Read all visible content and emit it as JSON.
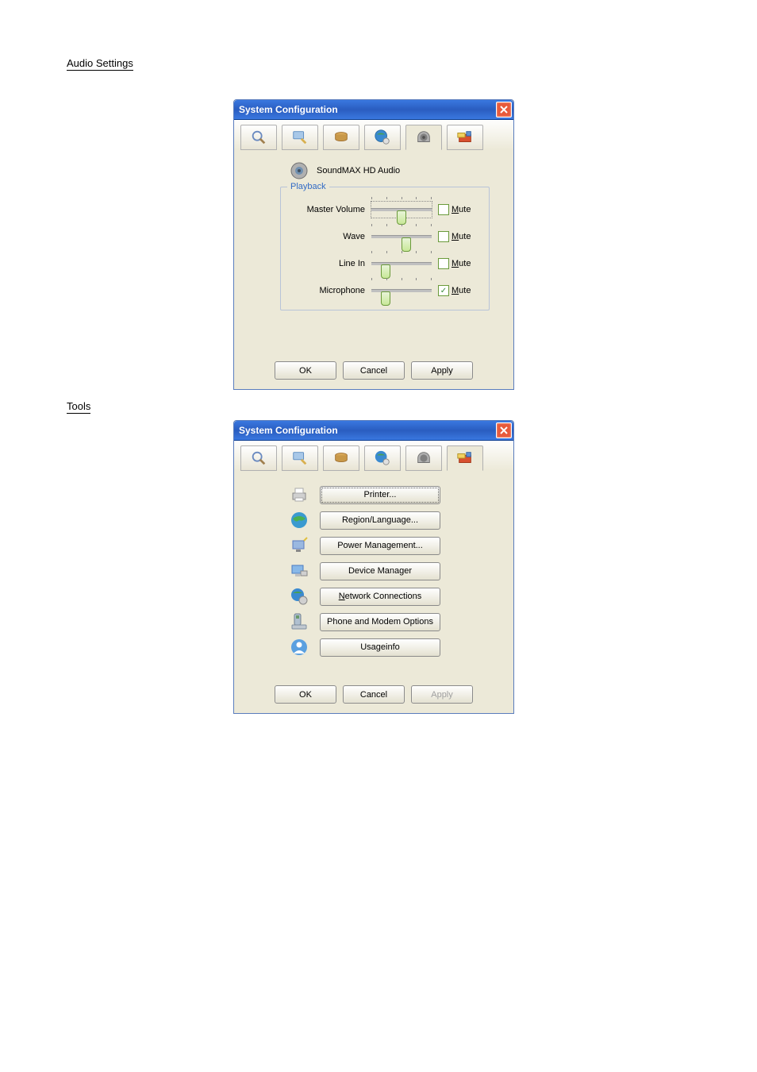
{
  "sections": {
    "audio_label": "Audio Settings",
    "tools_label": "Tools"
  },
  "dialog1": {
    "title": "System Configuration",
    "audio_device": "SoundMAX HD Audio",
    "group_title": "Playback",
    "sliders": [
      {
        "label": "Master Volume",
        "position": 48,
        "mute": false,
        "focused": true
      },
      {
        "label": "Wave",
        "position": 58,
        "mute": false,
        "focused": false
      },
      {
        "label": "Line In",
        "position": 18,
        "mute": false,
        "focused": false
      },
      {
        "label": "Microphone",
        "position": 18,
        "mute": true,
        "focused": false
      }
    ],
    "mute_label": "Mute",
    "buttons": {
      "ok": "OK",
      "cancel": "Cancel",
      "apply": "Apply"
    }
  },
  "dialog2": {
    "title": "System Configuration",
    "items": [
      {
        "label": "Printer...",
        "icon": "printer",
        "underline": null,
        "focused": true
      },
      {
        "label": "Region/Language...",
        "icon": "globe",
        "underline": null,
        "focused": false
      },
      {
        "label": "Power Management...",
        "icon": "power",
        "underline": null,
        "focused": false
      },
      {
        "label": "Device Manager",
        "icon": "device",
        "underline": null,
        "focused": false
      },
      {
        "label": "Network Connections",
        "icon": "network",
        "underline": "N",
        "focused": false
      },
      {
        "label": "Phone and Modem Options",
        "icon": "modem",
        "underline": null,
        "focused": false
      },
      {
        "label": "Usageinfo",
        "icon": "user",
        "underline": null,
        "focused": false
      }
    ],
    "buttons": {
      "ok": "OK",
      "cancel": "Cancel",
      "apply": "Apply",
      "apply_disabled": true
    }
  },
  "tabs": [
    "general",
    "display",
    "disk",
    "network",
    "audio",
    "tools"
  ]
}
